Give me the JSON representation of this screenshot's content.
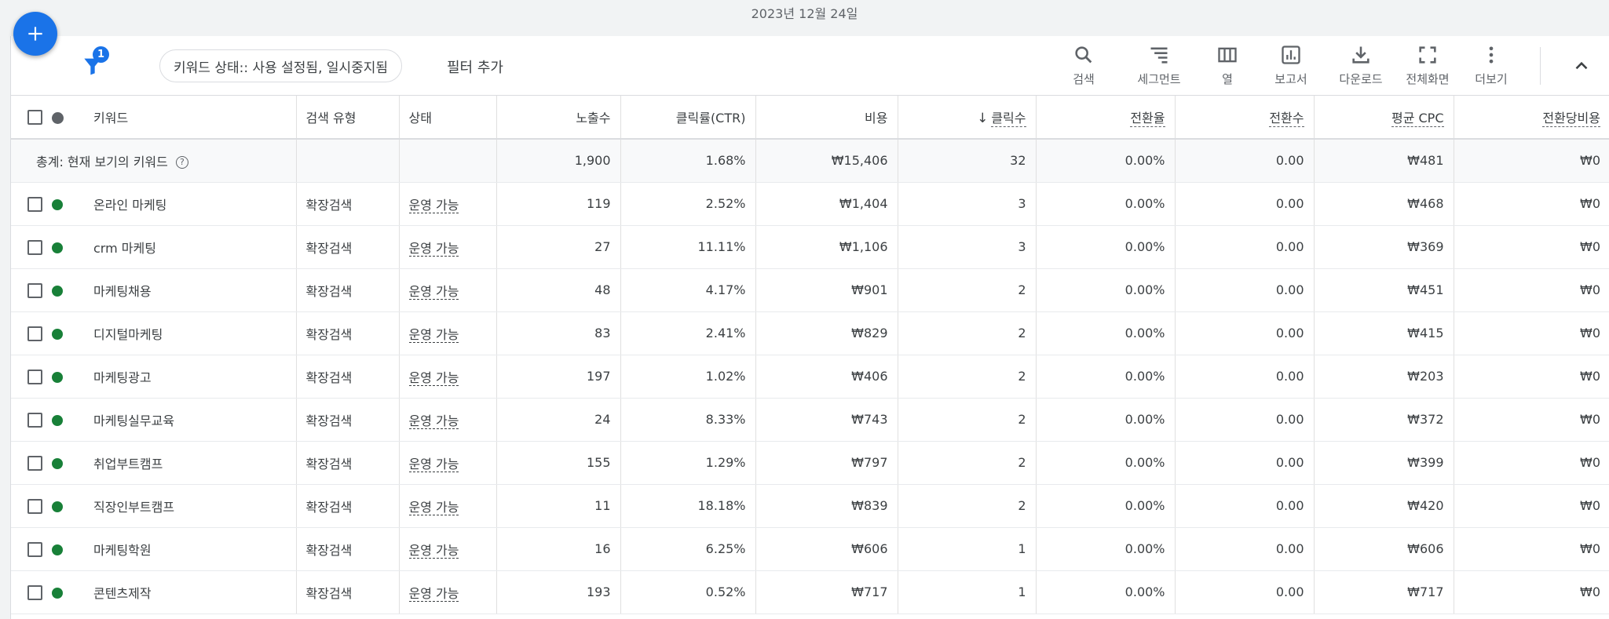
{
  "header": {
    "date": "2023년 12월 24일"
  },
  "toolbar": {
    "filter_badge": "1",
    "filter_chip": "키워드 상태:: 사용 설정됨, 일시중지됨",
    "add_filter": "필터 추가",
    "tools": [
      {
        "icon": "search-icon",
        "label": "검색"
      },
      {
        "icon": "segment-icon",
        "label": "세그먼트"
      },
      {
        "icon": "columns-icon",
        "label": "열"
      },
      {
        "icon": "report-icon",
        "label": "보고서"
      },
      {
        "icon": "download-icon",
        "label": "다운로드"
      },
      {
        "icon": "fullscreen-icon",
        "label": "전체화면"
      },
      {
        "icon": "more-vert-icon",
        "label": "더보기"
      }
    ]
  },
  "table": {
    "columns": {
      "keyword": "키워드",
      "match_type": "검색 유형",
      "status": "상태",
      "impressions": "노출수",
      "ctr": "클릭률(CTR)",
      "cost": "비용",
      "clicks": "클릭수",
      "conv_rate": "전환율",
      "conversions": "전환수",
      "avg_cpc": "평균 CPC",
      "cost_per_conv": "전환당비용"
    },
    "sort_icon": "arrow-down-icon",
    "total": {
      "label": "총계: 현재 보기의 키워드",
      "impressions": "1,900",
      "ctr": "1.68%",
      "cost": "₩15,406",
      "clicks": "32",
      "conv_rate": "0.00%",
      "conversions": "0.00",
      "avg_cpc": "₩481",
      "cost_per_conv": "₩0"
    },
    "rows": [
      {
        "keyword": "온라인 마케팅",
        "match_type": "확장검색",
        "status": "운영 가능",
        "impressions": "119",
        "ctr": "2.52%",
        "cost": "₩1,404",
        "clicks": "3",
        "conv_rate": "0.00%",
        "conversions": "0.00",
        "avg_cpc": "₩468",
        "cost_per_conv": "₩0"
      },
      {
        "keyword": "crm 마케팅",
        "match_type": "확장검색",
        "status": "운영 가능",
        "impressions": "27",
        "ctr": "11.11%",
        "cost": "₩1,106",
        "clicks": "3",
        "conv_rate": "0.00%",
        "conversions": "0.00",
        "avg_cpc": "₩369",
        "cost_per_conv": "₩0"
      },
      {
        "keyword": "마케팅채용",
        "match_type": "확장검색",
        "status": "운영 가능",
        "impressions": "48",
        "ctr": "4.17%",
        "cost": "₩901",
        "clicks": "2",
        "conv_rate": "0.00%",
        "conversions": "0.00",
        "avg_cpc": "₩451",
        "cost_per_conv": "₩0"
      },
      {
        "keyword": "디지털마케팅",
        "match_type": "확장검색",
        "status": "운영 가능",
        "impressions": "83",
        "ctr": "2.41%",
        "cost": "₩829",
        "clicks": "2",
        "conv_rate": "0.00%",
        "conversions": "0.00",
        "avg_cpc": "₩415",
        "cost_per_conv": "₩0"
      },
      {
        "keyword": "마케팅광고",
        "match_type": "확장검색",
        "status": "운영 가능",
        "impressions": "197",
        "ctr": "1.02%",
        "cost": "₩406",
        "clicks": "2",
        "conv_rate": "0.00%",
        "conversions": "0.00",
        "avg_cpc": "₩203",
        "cost_per_conv": "₩0"
      },
      {
        "keyword": "마케팅실무교육",
        "match_type": "확장검색",
        "status": "운영 가능",
        "impressions": "24",
        "ctr": "8.33%",
        "cost": "₩743",
        "clicks": "2",
        "conv_rate": "0.00%",
        "conversions": "0.00",
        "avg_cpc": "₩372",
        "cost_per_conv": "₩0"
      },
      {
        "keyword": "취업부트캠프",
        "match_type": "확장검색",
        "status": "운영 가능",
        "impressions": "155",
        "ctr": "1.29%",
        "cost": "₩797",
        "clicks": "2",
        "conv_rate": "0.00%",
        "conversions": "0.00",
        "avg_cpc": "₩399",
        "cost_per_conv": "₩0"
      },
      {
        "keyword": "직장인부트캠프",
        "match_type": "확장검색",
        "status": "운영 가능",
        "impressions": "11",
        "ctr": "18.18%",
        "cost": "₩839",
        "clicks": "2",
        "conv_rate": "0.00%",
        "conversions": "0.00",
        "avg_cpc": "₩420",
        "cost_per_conv": "₩0"
      },
      {
        "keyword": "마케팅학원",
        "match_type": "확장검색",
        "status": "운영 가능",
        "impressions": "16",
        "ctr": "6.25%",
        "cost": "₩606",
        "clicks": "1",
        "conv_rate": "0.00%",
        "conversions": "0.00",
        "avg_cpc": "₩606",
        "cost_per_conv": "₩0"
      },
      {
        "keyword": "콘텐츠제작",
        "match_type": "확장검색",
        "status": "운영 가능",
        "impressions": "193",
        "ctr": "0.52%",
        "cost": "₩717",
        "clicks": "1",
        "conv_rate": "0.00%",
        "conversions": "0.00",
        "avg_cpc": "₩717",
        "cost_per_conv": "₩0"
      }
    ]
  },
  "colors": {
    "accent": "#1a73e8",
    "status_enabled": "#188038"
  }
}
